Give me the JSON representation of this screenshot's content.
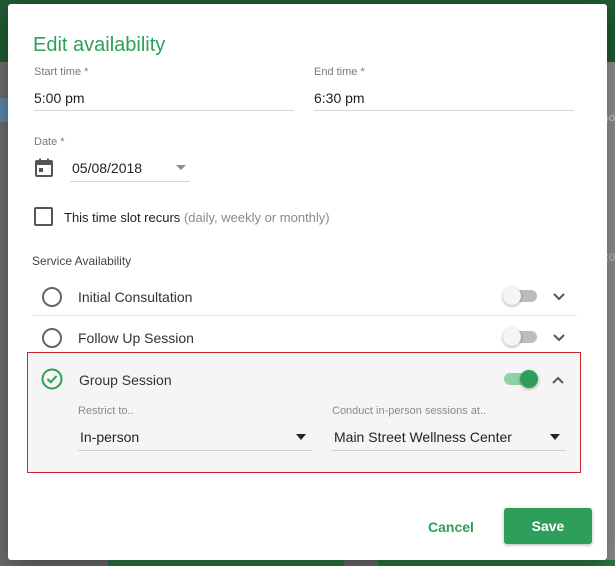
{
  "dialog": {
    "title": "Edit availability",
    "start_time": {
      "label": "Start time *",
      "value": "5:00 pm"
    },
    "end_time": {
      "label": "End time *",
      "value": "6:30 pm"
    },
    "date": {
      "label": "Date *",
      "value": "05/08/2018"
    },
    "recurs": {
      "checked": false,
      "label": "This time slot recurs",
      "hint": "(daily, weekly or monthly)"
    },
    "service_availability": {
      "label": "Service Availability",
      "services": [
        {
          "name": "Initial Consultation",
          "selected": false,
          "enabled": false,
          "expanded": false
        },
        {
          "name": "Follow Up Session",
          "selected": false,
          "enabled": false,
          "expanded": false
        },
        {
          "name": "Group Session",
          "selected": true,
          "enabled": true,
          "expanded": true
        }
      ],
      "group_details": {
        "restrict_label": "Restrict to..",
        "restrict_value": "In-person",
        "location_label": "Conduct in-person sessions at..",
        "location_value": "Main Street Wellness Center"
      }
    },
    "buttons": {
      "cancel": "Cancel",
      "save": "Save"
    }
  },
  "colors": {
    "accent": "#2e9e5b",
    "highlight_border": "#c9252b",
    "toggle_off": "#bdbdbd"
  }
}
